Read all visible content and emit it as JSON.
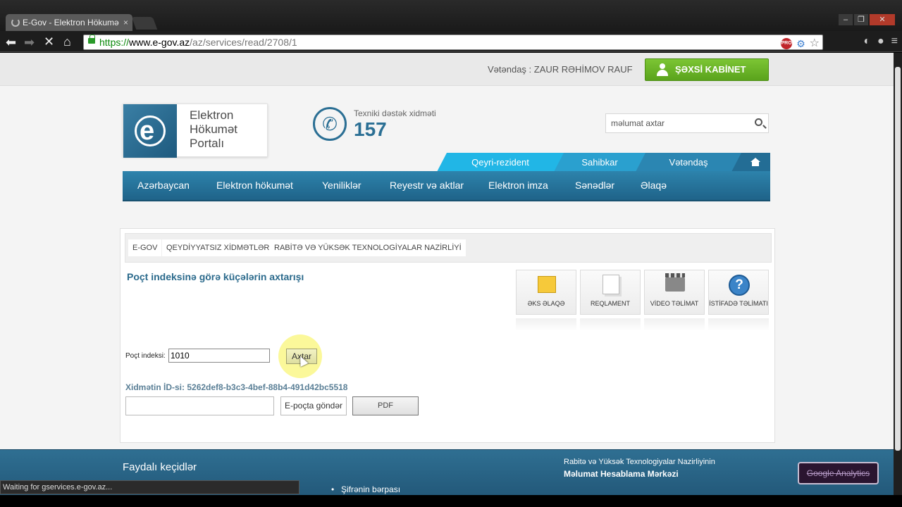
{
  "browser": {
    "tab_title": "E-Gov - Elektron Hökumə",
    "tab_close": "×",
    "url_scheme": "https://",
    "url_host": "www.e-gov.az",
    "url_path": "/az/services/read/2708/1",
    "ext_badge": "PRO",
    "status_text": "Waiting for gservices.e-gov.az..."
  },
  "topbar": {
    "citizen": "Vətəndaş : ZAUR RƏHİMOV RAUF",
    "cabinet_button": "ŞƏXSİ KABİNET"
  },
  "header": {
    "logo_line1": "Elektron",
    "logo_line2": "Hökumət",
    "logo_line3": "Portalı",
    "support_label": "Texniki dəstək xidməti",
    "support_number": "157",
    "search_placeholder": "məlumat axtar"
  },
  "category_tabs": [
    "Qeyri-rezident",
    "Sahibkar",
    "Vətəndaş"
  ],
  "main_nav": [
    "Azərbaycan",
    "Elektron hökumət",
    "Yeniliklər",
    "Reyestr və aktlar",
    "Elektron imza",
    "Sənədlər",
    "Əlaqə"
  ],
  "breadcrumbs": [
    "E-GOV",
    "QEYDİYYATSIZ XİDMƏTLƏR",
    "RABİTƏ VƏ YÜKSƏK TEXNOLOGİYALAR NAZİRLİYİ"
  ],
  "service": {
    "title": "Poçt indeksinə görə küçələrin axtarışı",
    "index_label": "Poçt indeksi:",
    "index_value": "1010",
    "search_button": "Axtar",
    "service_id": "Xidmətin İD-si: 5262def8-b3c3-4bef-88b4-491d42bc5518",
    "email_button": "E-poçta göndər",
    "pdf_button": "PDF"
  },
  "tools": [
    "ƏKS ƏLAQƏ",
    "REQLAMENT",
    "VİDEO TƏLİMAT",
    "İSTİFADƏ TƏLİMATI"
  ],
  "footer": {
    "title": "Faydalı keçidlər",
    "link1": "Şifrənin bərpası",
    "org_line1": "Rabitə və Yüksək Texnologiyalar Nazirliyinin",
    "org_line2": "Məlumat Hesablama Mərkəzi",
    "ga_button": "Google Analytics"
  },
  "colors": {
    "accent_green": "#6ab829",
    "nav_blue": "#2672a0",
    "tab_cyan": "#21b6e6"
  }
}
